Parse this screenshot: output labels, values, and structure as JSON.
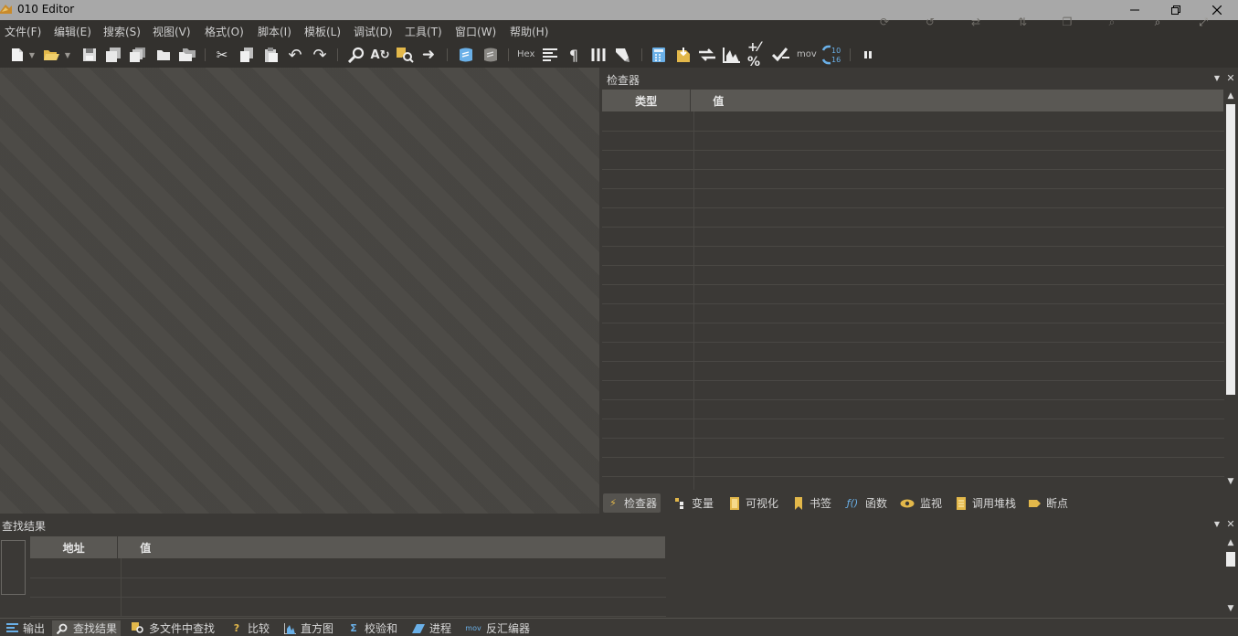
{
  "window": {
    "title": "010 Editor"
  },
  "menu": [
    "文件(F)",
    "编辑(E)",
    "搜索(S)",
    "视图(V)",
    "格式(O)",
    "脚本(I)",
    "模板(L)",
    "调试(D)",
    "工具(T)",
    "窗口(W)",
    "帮助(H)"
  ],
  "toolbar": {
    "hex_label": "Hex",
    "mov_label": "mov",
    "num_top": "10",
    "num_bottom": "16"
  },
  "inspector": {
    "title": "检查器",
    "columns": [
      "类型",
      "值"
    ],
    "tabs": [
      "检查器",
      "变量",
      "可视化",
      "书签",
      "函数",
      "监视",
      "调用堆栈",
      "断点"
    ]
  },
  "find_results": {
    "title": "查找结果",
    "columns": [
      "地址",
      "值"
    ]
  },
  "bottom_tabs": [
    "输出",
    "查找结果",
    "多文件中查找",
    "比较",
    "直方图",
    "校验和",
    "进程",
    "反汇编器"
  ],
  "colors": {
    "accent": "#e3b84a",
    "blue_icon": "#6ab0e8",
    "panel_bg": "#3b3936",
    "editor_bg": "#494743"
  }
}
